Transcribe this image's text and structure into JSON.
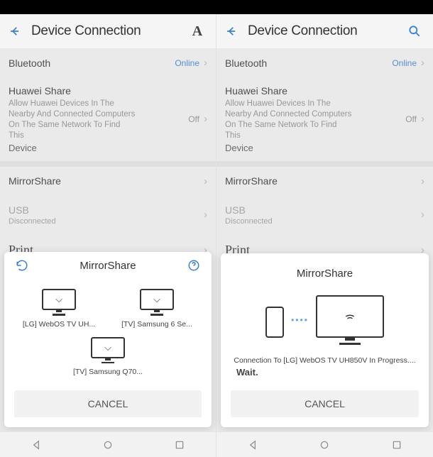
{
  "colors": {
    "accent": "#3a7fd6"
  },
  "header": {
    "title": "Device Connection",
    "leftGlyph": "A"
  },
  "settings": {
    "bluetooth": {
      "label": "Bluetooth",
      "value": "Online"
    },
    "huawei": {
      "title": "Huawei Share",
      "desc": "Allow Huawei Devices In The Nearby And Connected Computers On The Same Network To Find This",
      "device": "Device",
      "value": "Off"
    },
    "mirrorshare": {
      "label": "MirrorShare"
    },
    "usb": {
      "label": "USB",
      "sub": "Disconnected"
    },
    "print": {
      "label": "Print"
    }
  },
  "sheet1": {
    "title": "MirrorShare",
    "devices": [
      {
        "label": "[LG] WebOS TV UH..."
      },
      {
        "label": "[TV] Samsung 6 Se..."
      },
      {
        "label": "[TV] Samsung Q70..."
      }
    ],
    "cancel": "CANCEL"
  },
  "sheet2": {
    "title": "MirrorShare",
    "status": "Connection To [LG] WebOS TV UH850V In Progress....",
    "wait": "Wait.",
    "cancel": "CANCEL"
  },
  "nav": {
    "back": "back",
    "home": "home",
    "recent": "recent"
  }
}
